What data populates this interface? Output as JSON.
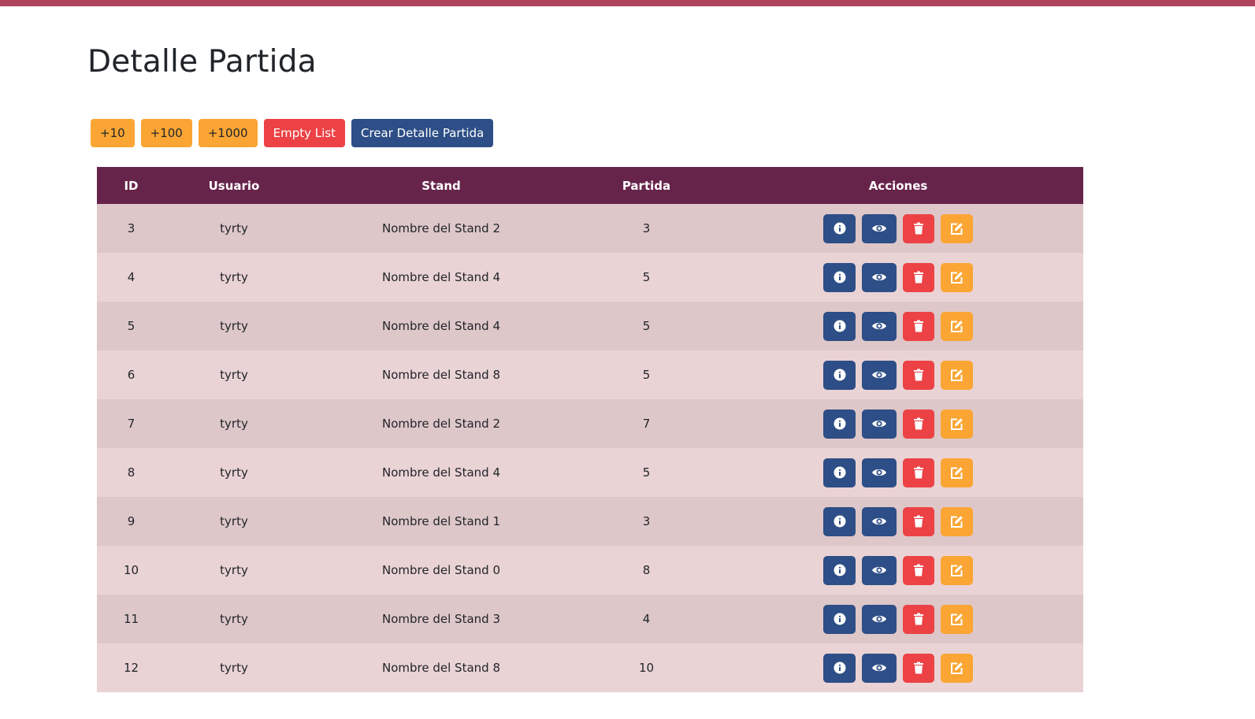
{
  "page": {
    "title": "Detalle Partida"
  },
  "toolbar": {
    "add10_label": "+10",
    "add100_label": "+100",
    "add1000_label": "+1000",
    "empty_label": "Empty List",
    "create_label": "Crear Detalle Partida"
  },
  "table": {
    "columns": [
      "ID",
      "Usuario",
      "Stand",
      "Partida",
      "Acciones"
    ],
    "rows": [
      {
        "id": "3",
        "usuario": "tyrty",
        "stand": "Nombre del Stand 2",
        "partida": "3"
      },
      {
        "id": "4",
        "usuario": "tyrty",
        "stand": "Nombre del Stand 4",
        "partida": "5"
      },
      {
        "id": "5",
        "usuario": "tyrty",
        "stand": "Nombre del Stand 4",
        "partida": "5"
      },
      {
        "id": "6",
        "usuario": "tyrty",
        "stand": "Nombre del Stand 8",
        "partida": "5"
      },
      {
        "id": "7",
        "usuario": "tyrty",
        "stand": "Nombre del Stand 2",
        "partida": "7"
      },
      {
        "id": "8",
        "usuario": "tyrty",
        "stand": "Nombre del Stand 4",
        "partida": "5"
      },
      {
        "id": "9",
        "usuario": "tyrty",
        "stand": "Nombre del Stand 1",
        "partida": "3"
      },
      {
        "id": "10",
        "usuario": "tyrty",
        "stand": "Nombre del Stand 0",
        "partida": "8"
      },
      {
        "id": "11",
        "usuario": "tyrty",
        "stand": "Nombre del Stand 3",
        "partida": "4"
      },
      {
        "id": "12",
        "usuario": "tyrty",
        "stand": "Nombre del Stand 8",
        "partida": "10"
      }
    ],
    "row_actions": [
      "info-icon",
      "eye-icon",
      "trash-icon",
      "edit-icon"
    ]
  },
  "colors": {
    "top_bar": "#b0435e",
    "header": "#67244b",
    "row_odd": "#dec7c9",
    "row_even": "#ead3d5",
    "primary": "#2d4e86",
    "danger": "#ec4245",
    "warning": "#fba534"
  }
}
